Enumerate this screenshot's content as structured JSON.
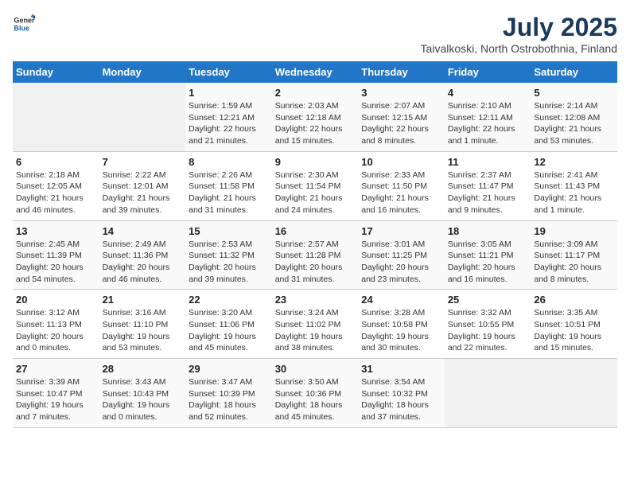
{
  "header": {
    "logo_general": "General",
    "logo_blue": "Blue",
    "month_year": "July 2025",
    "location": "Taivalkoski, North Ostrobothnia, Finland"
  },
  "weekdays": [
    "Sunday",
    "Monday",
    "Tuesday",
    "Wednesday",
    "Thursday",
    "Friday",
    "Saturday"
  ],
  "weeks": [
    [
      {
        "day": "",
        "detail": ""
      },
      {
        "day": "",
        "detail": ""
      },
      {
        "day": "1",
        "detail": "Sunrise: 1:59 AM\nSunset: 12:21 AM\nDaylight: 22 hours\nand 21 minutes."
      },
      {
        "day": "2",
        "detail": "Sunrise: 2:03 AM\nSunset: 12:18 AM\nDaylight: 22 hours\nand 15 minutes."
      },
      {
        "day": "3",
        "detail": "Sunrise: 2:07 AM\nSunset: 12:15 AM\nDaylight: 22 hours\nand 8 minutes."
      },
      {
        "day": "4",
        "detail": "Sunrise: 2:10 AM\nSunset: 12:11 AM\nDaylight: 22 hours\nand 1 minute."
      },
      {
        "day": "5",
        "detail": "Sunrise: 2:14 AM\nSunset: 12:08 AM\nDaylight: 21 hours\nand 53 minutes."
      }
    ],
    [
      {
        "day": "6",
        "detail": "Sunrise: 2:18 AM\nSunset: 12:05 AM\nDaylight: 21 hours\nand 46 minutes."
      },
      {
        "day": "7",
        "detail": "Sunrise: 2:22 AM\nSunset: 12:01 AM\nDaylight: 21 hours\nand 39 minutes."
      },
      {
        "day": "8",
        "detail": "Sunrise: 2:26 AM\nSunset: 11:58 PM\nDaylight: 21 hours\nand 31 minutes."
      },
      {
        "day": "9",
        "detail": "Sunrise: 2:30 AM\nSunset: 11:54 PM\nDaylight: 21 hours\nand 24 minutes."
      },
      {
        "day": "10",
        "detail": "Sunrise: 2:33 AM\nSunset: 11:50 PM\nDaylight: 21 hours\nand 16 minutes."
      },
      {
        "day": "11",
        "detail": "Sunrise: 2:37 AM\nSunset: 11:47 PM\nDaylight: 21 hours\nand 9 minutes."
      },
      {
        "day": "12",
        "detail": "Sunrise: 2:41 AM\nSunset: 11:43 PM\nDaylight: 21 hours\nand 1 minute."
      }
    ],
    [
      {
        "day": "13",
        "detail": "Sunrise: 2:45 AM\nSunset: 11:39 PM\nDaylight: 20 hours\nand 54 minutes."
      },
      {
        "day": "14",
        "detail": "Sunrise: 2:49 AM\nSunset: 11:36 PM\nDaylight: 20 hours\nand 46 minutes."
      },
      {
        "day": "15",
        "detail": "Sunrise: 2:53 AM\nSunset: 11:32 PM\nDaylight: 20 hours\nand 39 minutes."
      },
      {
        "day": "16",
        "detail": "Sunrise: 2:57 AM\nSunset: 11:28 PM\nDaylight: 20 hours\nand 31 minutes."
      },
      {
        "day": "17",
        "detail": "Sunrise: 3:01 AM\nSunset: 11:25 PM\nDaylight: 20 hours\nand 23 minutes."
      },
      {
        "day": "18",
        "detail": "Sunrise: 3:05 AM\nSunset: 11:21 PM\nDaylight: 20 hours\nand 16 minutes."
      },
      {
        "day": "19",
        "detail": "Sunrise: 3:09 AM\nSunset: 11:17 PM\nDaylight: 20 hours\nand 8 minutes."
      }
    ],
    [
      {
        "day": "20",
        "detail": "Sunrise: 3:12 AM\nSunset: 11:13 PM\nDaylight: 20 hours\nand 0 minutes."
      },
      {
        "day": "21",
        "detail": "Sunrise: 3:16 AM\nSunset: 11:10 PM\nDaylight: 19 hours\nand 53 minutes."
      },
      {
        "day": "22",
        "detail": "Sunrise: 3:20 AM\nSunset: 11:06 PM\nDaylight: 19 hours\nand 45 minutes."
      },
      {
        "day": "23",
        "detail": "Sunrise: 3:24 AM\nSunset: 11:02 PM\nDaylight: 19 hours\nand 38 minutes."
      },
      {
        "day": "24",
        "detail": "Sunrise: 3:28 AM\nSunset: 10:58 PM\nDaylight: 19 hours\nand 30 minutes."
      },
      {
        "day": "25",
        "detail": "Sunrise: 3:32 AM\nSunset: 10:55 PM\nDaylight: 19 hours\nand 22 minutes."
      },
      {
        "day": "26",
        "detail": "Sunrise: 3:35 AM\nSunset: 10:51 PM\nDaylight: 19 hours\nand 15 minutes."
      }
    ],
    [
      {
        "day": "27",
        "detail": "Sunrise: 3:39 AM\nSunset: 10:47 PM\nDaylight: 19 hours\nand 7 minutes."
      },
      {
        "day": "28",
        "detail": "Sunrise: 3:43 AM\nSunset: 10:43 PM\nDaylight: 19 hours\nand 0 minutes."
      },
      {
        "day": "29",
        "detail": "Sunrise: 3:47 AM\nSunset: 10:39 PM\nDaylight: 18 hours\nand 52 minutes."
      },
      {
        "day": "30",
        "detail": "Sunrise: 3:50 AM\nSunset: 10:36 PM\nDaylight: 18 hours\nand 45 minutes."
      },
      {
        "day": "31",
        "detail": "Sunrise: 3:54 AM\nSunset: 10:32 PM\nDaylight: 18 hours\nand 37 minutes."
      },
      {
        "day": "",
        "detail": ""
      },
      {
        "day": "",
        "detail": ""
      }
    ]
  ]
}
